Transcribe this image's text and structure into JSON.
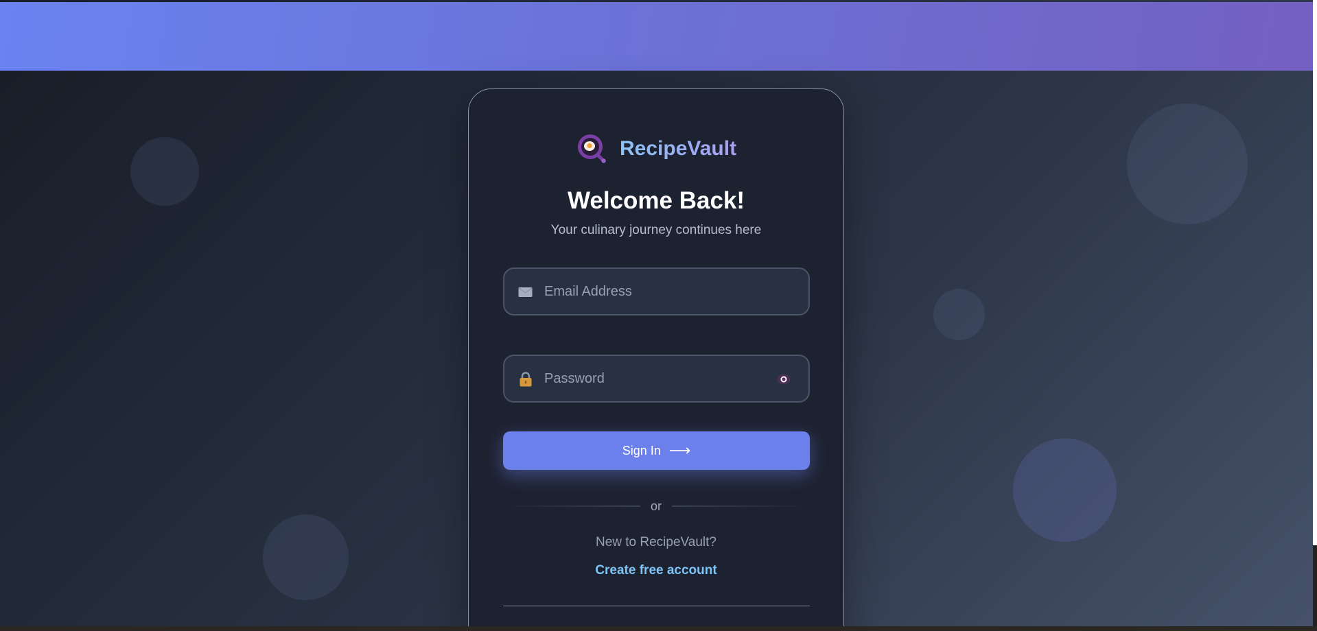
{
  "brand": {
    "name": "RecipeVault",
    "logo_icon": "magnifier-fried-egg-icon"
  },
  "login": {
    "heading": "Welcome Back!",
    "subheading": "Your culinary journey continues here",
    "email": {
      "placeholder": "Email Address",
      "value": "",
      "icon": "envelope-icon"
    },
    "password": {
      "placeholder": "Password",
      "value": "",
      "icon": "lock-icon",
      "toggle_icon": "eye-icon"
    },
    "submit": {
      "label": "Sign In",
      "arrow": "⟶"
    },
    "divider": "or",
    "signup_prompt": "New to RecipeVault?",
    "signup_link": "Create free account"
  },
  "colors": {
    "accent": "#6b80ea",
    "link": "#7ec3f5",
    "card_background": "#1d2230",
    "header_gradient_start": "#6a83f0",
    "header_gradient_end": "#7460c2"
  }
}
